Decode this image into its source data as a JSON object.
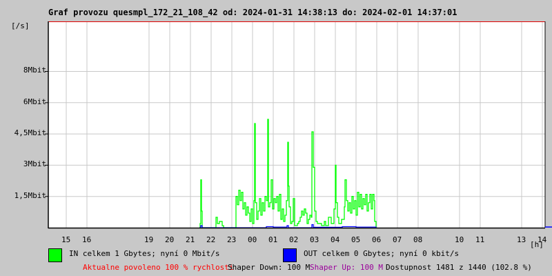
{
  "title": "Graf provozu quesmpl_172_21_108_42 od: 2024-01-31 14:38:13 do: 2024-02-01 14:37:01",
  "chart_data": {
    "type": "line",
    "title": "Graf provozu quesmpl_172_21_108_42 od: 2024-01-31 14:38:13 do: 2024-02-01 14:37:01",
    "ylabel": "[/s]",
    "xlabel": "[h]",
    "x_units": "minutes since 2024-01-31 14:00",
    "xlim": [
      8,
      1448
    ],
    "ylim": [
      0,
      9.9
    ],
    "y_unit": "Mbit/s",
    "grid": true,
    "y_ticks": [
      {
        "label": "8Mbit",
        "value": 7.5
      },
      {
        "label": "6Mbit",
        "value": 6.0
      },
      {
        "label": "4,5Mbit",
        "value": 4.5
      },
      {
        "label": "3Mbit",
        "value": 3.0
      },
      {
        "label": "1,5Mbit",
        "value": 1.5
      }
    ],
    "x_ticks": [
      {
        "label": "15",
        "value": 60
      },
      {
        "label": "16",
        "value": 120
      },
      {
        "label": "19",
        "value": 300
      },
      {
        "label": "20",
        "value": 360
      },
      {
        "label": "21",
        "value": 420
      },
      {
        "label": "22",
        "value": 480
      },
      {
        "label": "23",
        "value": 540
      },
      {
        "label": "00",
        "value": 600
      },
      {
        "label": "01",
        "value": 660
      },
      {
        "label": "02",
        "value": 720
      },
      {
        "label": "03",
        "value": 780
      },
      {
        "label": "04",
        "value": 840
      },
      {
        "label": "05",
        "value": 900
      },
      {
        "label": "06",
        "value": 960
      },
      {
        "label": "07",
        "value": 1020
      },
      {
        "label": "08",
        "value": 1080
      },
      {
        "label": "10",
        "value": 1200
      },
      {
        "label": "11",
        "value": 1260
      },
      {
        "label": "13",
        "value": 1380
      },
      {
        "label": "14",
        "value": 1440
      }
    ],
    "limit_line": {
      "value": 9.9,
      "color": "#e00000"
    },
    "series": [
      {
        "name": "IN",
        "color": "#00ff00",
        "points": [
          [
            446,
            0
          ],
          [
            448,
            0.2
          ],
          [
            450,
            2.3
          ],
          [
            452,
            0.8
          ],
          [
            454,
            0
          ],
          [
            492,
            0
          ],
          [
            494,
            0.5
          ],
          [
            498,
            0.2
          ],
          [
            504,
            0.3
          ],
          [
            512,
            0.1
          ],
          [
            516,
            0
          ],
          [
            550,
            0
          ],
          [
            552,
            1.5
          ],
          [
            556,
            1.1
          ],
          [
            560,
            1.8
          ],
          [
            564,
            1.3
          ],
          [
            568,
            1.7
          ],
          [
            572,
            0.9
          ],
          [
            576,
            1.2
          ],
          [
            580,
            0.6
          ],
          [
            584,
            1.0
          ],
          [
            588,
            0.7
          ],
          [
            592,
            0.3
          ],
          [
            596,
            0.9
          ],
          [
            600,
            0.2
          ],
          [
            604,
            1.3
          ],
          [
            606,
            5.0
          ],
          [
            608,
            1.2
          ],
          [
            612,
            0.4
          ],
          [
            616,
            0.8
          ],
          [
            620,
            1.4
          ],
          [
            624,
            0.6
          ],
          [
            628,
            1.2
          ],
          [
            632,
            0.8
          ],
          [
            636,
            1.5
          ],
          [
            640,
            1.3
          ],
          [
            644,
            5.2
          ],
          [
            646,
            1.0
          ],
          [
            650,
            1.2
          ],
          [
            654,
            2.3
          ],
          [
            658,
            0.9
          ],
          [
            662,
            1.4
          ],
          [
            666,
            1.2
          ],
          [
            670,
            1.5
          ],
          [
            674,
            0.8
          ],
          [
            678,
            1.6
          ],
          [
            682,
            0.4
          ],
          [
            686,
            0.9
          ],
          [
            690,
            0.3
          ],
          [
            694,
            0.6
          ],
          [
            698,
            1.3
          ],
          [
            702,
            4.1
          ],
          [
            704,
            2.0
          ],
          [
            706,
            1.0
          ],
          [
            710,
            0.2
          ],
          [
            714,
            0.3
          ],
          [
            718,
            1.4
          ],
          [
            722,
            0.1
          ],
          [
            730,
            0.2
          ],
          [
            734,
            0.3
          ],
          [
            738,
            0.5
          ],
          [
            742,
            0.8
          ],
          [
            746,
            0.6
          ],
          [
            750,
            0.9
          ],
          [
            754,
            0.7
          ],
          [
            758,
            0.2
          ],
          [
            762,
            0.4
          ],
          [
            766,
            0.6
          ],
          [
            770,
            0.5
          ],
          [
            772,
            4.6
          ],
          [
            776,
            2.9
          ],
          [
            780,
            0.8
          ],
          [
            784,
            0.3
          ],
          [
            788,
            0.2
          ],
          [
            796,
            0.2
          ],
          [
            800,
            0.1
          ],
          [
            808,
            0.3
          ],
          [
            812,
            0.1
          ],
          [
            820,
            0.5
          ],
          [
            828,
            0.2
          ],
          [
            836,
            0.9
          ],
          [
            840,
            3.0
          ],
          [
            842,
            1.2
          ],
          [
            846,
            0.5
          ],
          [
            850,
            0.2
          ],
          [
            858,
            0.4
          ],
          [
            866,
            1.0
          ],
          [
            868,
            2.3
          ],
          [
            872,
            1.3
          ],
          [
            876,
            0.8
          ],
          [
            880,
            1.2
          ],
          [
            884,
            0.7
          ],
          [
            888,
            1.5
          ],
          [
            892,
            0.9
          ],
          [
            896,
            1.3
          ],
          [
            900,
            0.6
          ],
          [
            904,
            1.7
          ],
          [
            908,
            1.0
          ],
          [
            912,
            1.6
          ],
          [
            916,
            0.9
          ],
          [
            920,
            1.4
          ],
          [
            924,
            1.1
          ],
          [
            928,
            1.6
          ],
          [
            932,
            0.8
          ],
          [
            936,
            1.2
          ],
          [
            940,
            1.6
          ],
          [
            944,
            0.9
          ],
          [
            948,
            1.6
          ],
          [
            952,
            1.3
          ],
          [
            954,
            0.3
          ],
          [
            958,
            0
          ]
        ]
      },
      {
        "name": "OUT",
        "color": "#0000ff",
        "points": [
          [
            446,
            0
          ],
          [
            450,
            0.1
          ],
          [
            454,
            0
          ],
          [
            600,
            0
          ],
          [
            640,
            0.05
          ],
          [
            660,
            0.03
          ],
          [
            700,
            0.1
          ],
          [
            704,
            0
          ],
          [
            772,
            0.15
          ],
          [
            776,
            0.02
          ],
          [
            860,
            0.05
          ],
          [
            900,
            0.03
          ],
          [
            958,
            0
          ]
        ]
      }
    ]
  },
  "legend": {
    "in": {
      "label": "IN celkem 1 Gbytes; nyní 0 Mbit/s",
      "color": "#00ff00"
    },
    "out": {
      "label": "OUT celkem 0 Gbytes; nyní 0 kbit/s",
      "color": "#0000ff"
    }
  },
  "footer": {
    "allowed": "Aktualne povoleno 100 % rychlosti",
    "allowed_color": "#ff0000",
    "shaper_down": "Shaper Down: 100 M",
    "shaper_up": "Shaper Up: 100 M",
    "shaper_up_color": "#990099",
    "availability": "Dostupnost 1481 z 1440 (102.8 %)"
  }
}
